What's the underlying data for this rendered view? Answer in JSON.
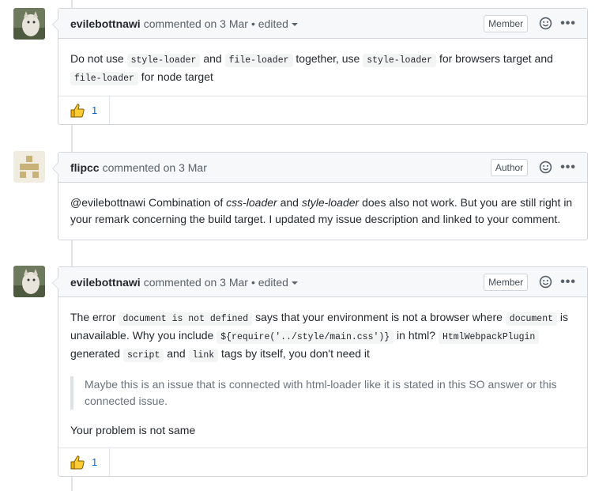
{
  "comments": [
    {
      "author": "evilebottnawi",
      "meta": "commented on 3 Mar",
      "edited": "• edited",
      "role": "Member",
      "body": {
        "t1": "Do not use ",
        "c1": "style-loader",
        "t2": " and ",
        "c2": "file-loader",
        "t3": " together, use ",
        "c3": "style-loader",
        "t4": " for browsers target and",
        "c4": "file-loader",
        "t5": " for node target"
      },
      "reaction": {
        "emoji": "thumbs-up",
        "count": "1"
      }
    },
    {
      "author": "flipcc",
      "meta": "commented on 3 Mar",
      "role": "Author",
      "body": {
        "t1": "@evilebottnawi Combination of ",
        "e1": "css-loader",
        "t2": " and ",
        "e2": "style-loader",
        "t3": " does also not work. But you are still right in your remark concerning the build target. I updated my issue description and linked to your comment."
      }
    },
    {
      "author": "evilebottnawi",
      "meta": "commented on 3 Mar",
      "edited": "• edited",
      "role": "Member",
      "body": {
        "t1": "The error ",
        "c1": "document is not defined",
        "t2": " says that your environment is not a browser where ",
        "c2": "document",
        "t3": " is unavailable. Why you include ",
        "c3": "${require('../style/main.css')}",
        "t4": " in html? ",
        "c4": "HtmlWebpackPlugin",
        "t5": " generated ",
        "c5": "script",
        "t6": " and ",
        "c6": "link",
        "t7": " tags by itself, you don't need it",
        "quote": "Maybe this is an issue that is connected with html-loader like it is stated in this SO answer or this connected issue.",
        "last": "Your problem is not same"
      },
      "reaction": {
        "emoji": "thumbs-up",
        "count": "1"
      }
    }
  ],
  "icons": {
    "reaction_picker": "smiley-icon",
    "more": "kebab-icon"
  },
  "colors": {
    "link": "#0366d6",
    "header_bg": "#f6f8fa",
    "border": "#d1d5da"
  }
}
